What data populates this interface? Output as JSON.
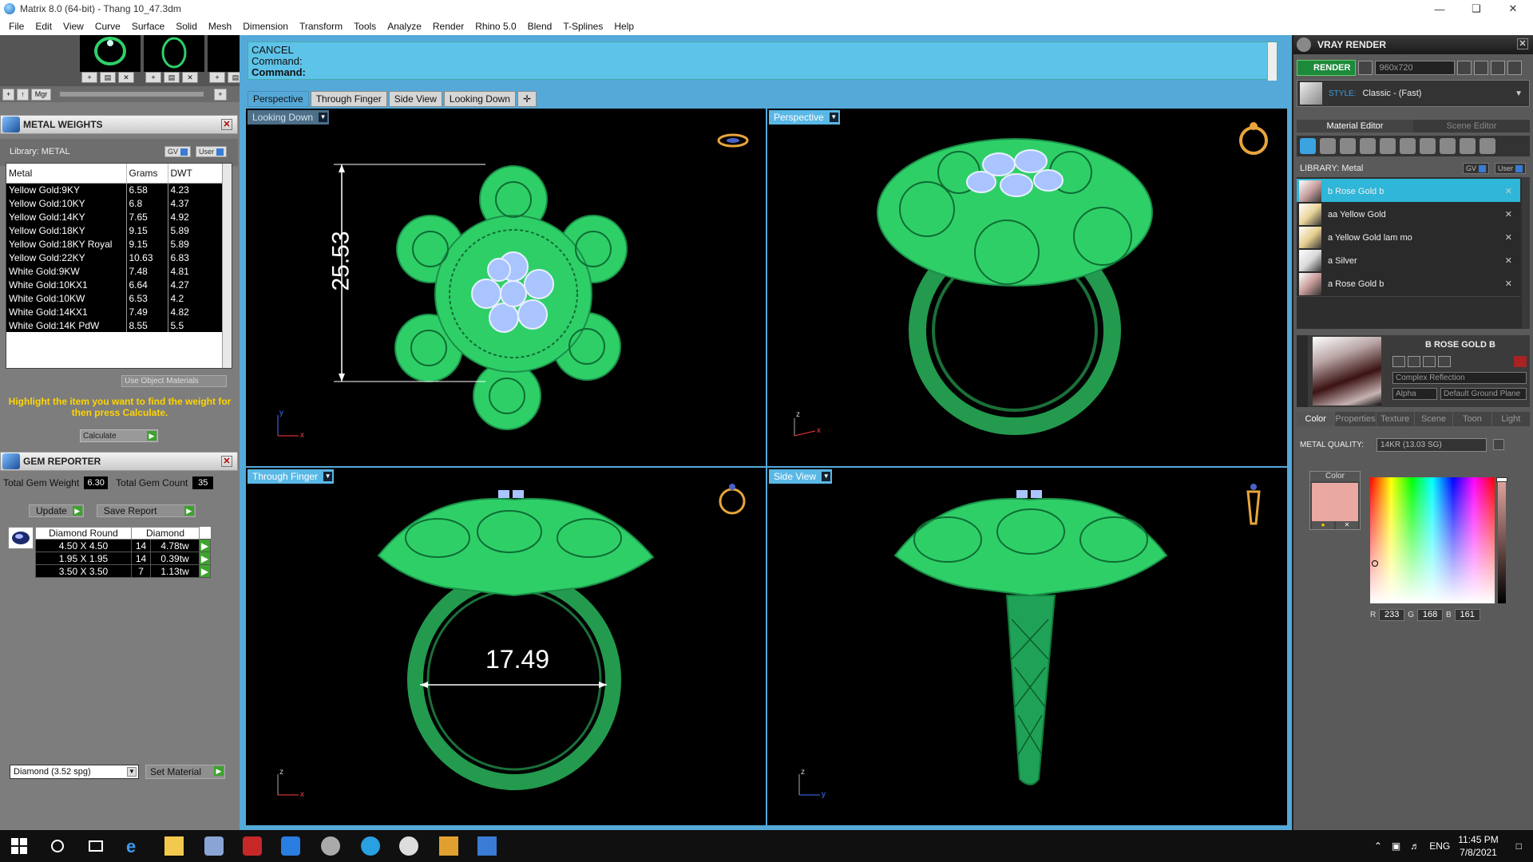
{
  "window": {
    "title": "Matrix 8.0 (64-bit) - Thang 10_47.3dm"
  },
  "menu": [
    "File",
    "Edit",
    "View",
    "Curve",
    "Surface",
    "Solid",
    "Mesh",
    "Dimension",
    "Transform",
    "Tools",
    "Analyze",
    "Render",
    "Rhino 5.0",
    "Blend",
    "T-Splines",
    "Help"
  ],
  "thumbbar": {
    "mgr": "Mgr"
  },
  "metal_weights": {
    "title": "METAL WEIGHTS",
    "library_label": "Library: METAL",
    "gv_label": "GV",
    "user_label": "User",
    "columns": [
      "Metal",
      "Grams",
      "DWT"
    ],
    "rows": [
      [
        "Yellow Gold:9KY",
        "6.58",
        "4.23"
      ],
      [
        "Yellow Gold:10KY",
        "6.8",
        "4.37"
      ],
      [
        "Yellow Gold:14KY",
        "7.65",
        "4.92"
      ],
      [
        "Yellow Gold:18KY",
        "9.15",
        "5.89"
      ],
      [
        "Yellow Gold:18KY Royal",
        "9.15",
        "5.89"
      ],
      [
        "Yellow Gold:22KY",
        "10.63",
        "6.83"
      ],
      [
        "White Gold:9KW",
        "7.48",
        "4.81"
      ],
      [
        "White Gold:10KX1",
        "6.64",
        "4.27"
      ],
      [
        "White Gold:10KW",
        "6.53",
        "4.2"
      ],
      [
        "White Gold:14KX1",
        "7.49",
        "4.82"
      ],
      [
        "White Gold:14K PdW",
        "8.55",
        "5.5"
      ]
    ],
    "use_object_materials": "Use Object Materials",
    "hint": "Highlight the item you want to find the weight for then press Calculate.",
    "calculate": "Calculate"
  },
  "gem_reporter": {
    "title": "GEM REPORTER",
    "total_weight_label": "Total Gem Weight",
    "total_weight": "6.30",
    "total_count_label": "Total Gem Count",
    "total_count": "35",
    "update": "Update",
    "save_report": "Save Report",
    "columns": [
      "Diamond Round",
      "",
      "Diamond"
    ],
    "rows": [
      [
        "4.50 X 4.50",
        "14",
        "4.78tw"
      ],
      [
        "1.95 X 1.95",
        "14",
        "0.39tw"
      ],
      [
        "3.50 X 3.50",
        "7",
        "1.13tw"
      ]
    ],
    "material_select": "Diamond     (3.52 spg)",
    "set_material": "Set Material"
  },
  "command": {
    "line1": "CANCEL",
    "line2": "Command:",
    "line3": "Command:"
  },
  "view_tabs": [
    "Perspective",
    "Through Finger",
    "Side View",
    "Looking Down"
  ],
  "active_view_tab": 0,
  "viewports": {
    "top_left": {
      "label": "Looking Down",
      "dimension": "25.53",
      "axis_a": "y",
      "axis_b": "x"
    },
    "top_right": {
      "label": "Perspective",
      "axis_a": "z",
      "axis_b": "x"
    },
    "bottom_left": {
      "label": "Through Finger",
      "dimension": "17.49",
      "axis_a": "z",
      "axis_b": "x"
    },
    "bottom_right": {
      "label": "Side View",
      "axis_a": "z",
      "axis_b": "y"
    }
  },
  "vray": {
    "title": "VRAY RENDER",
    "render": "RENDER",
    "resolution": "960x720",
    "style_label": "STYLE:",
    "style_value": "Classic - (Fast)",
    "tabs": [
      "Material Editor",
      "Scene Editor"
    ],
    "library_label": "LIBRARY: Metal",
    "gv_label": "GV",
    "user_label": "User",
    "materials": [
      {
        "name": "b Rose Gold b",
        "selected": true,
        "swatch": "#c9a0a0"
      },
      {
        "name": "aa Yellow Gold",
        "selected": false,
        "swatch": "#e9d59a"
      },
      {
        "name": "a Yellow Gold lam mo",
        "selected": false,
        "swatch": "#e6cf8e"
      },
      {
        "name": "a Silver",
        "selected": false,
        "swatch": "#d9d9d9"
      },
      {
        "name": "a Rose Gold b",
        "selected": false,
        "swatch": "#c79a97"
      }
    ],
    "material_title": "B ROSE GOLD B",
    "reflection": "Complex Reflection",
    "alpha": "Alpha",
    "ground": "Default Ground Plane",
    "prop_tabs": [
      "Color",
      "Properties",
      "Texture",
      "Scene",
      "Toon",
      "Light"
    ],
    "metal_quality_label": "METAL QUALITY:",
    "metal_quality": "14KR         (13.03 SG)",
    "color_label": "Color",
    "color_hex": "#e9a8a1",
    "r_label": "R",
    "r": "233",
    "g_label": "G",
    "g": "168",
    "b_label": "B",
    "b": "161"
  },
  "taskbar": {
    "lang": "ENG",
    "time": "11:45 PM",
    "date": "7/8/2021"
  },
  "colors": {
    "accent": "#55a9d8",
    "ring_green": "#2fd06a",
    "selected_material": "#2fb6d8"
  }
}
